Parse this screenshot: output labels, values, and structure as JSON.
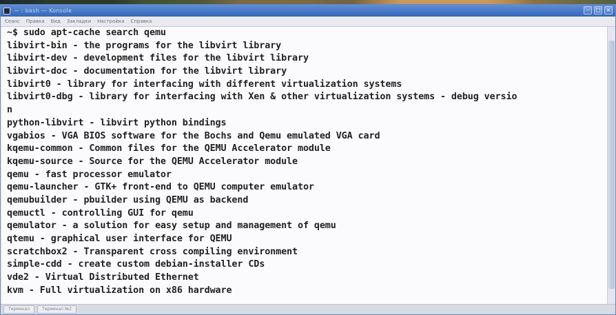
{
  "window": {
    "title": "~ : bash — Konsole",
    "menu": [
      "Сеанс",
      "Правка",
      "Вид",
      "Закладки",
      "Настройка",
      "Справка"
    ]
  },
  "terminal": {
    "lines": [
      "~$ sudo apt-cache search qemu",
      "libvirt-bin - the programs for the libvirt library",
      "libvirt-dev - development files for the libvirt library",
      "libvirt-doc - documentation for the libvirt library",
      "libvirt0 - library for interfacing with different virtualization systems",
      "libvirt0-dbg - library for interfacing with Xen & other virtualization systems - debug versio",
      "n",
      "python-libvirt - libvirt python bindings",
      "vgabios - VGA BIOS software for the Bochs and Qemu emulated VGA card",
      "kqemu-common - Common files for the QEMU Accelerator module",
      "kqemu-source - Source for the QEMU Accelerator module",
      "qemu - fast processor emulator",
      "qemu-launcher - GTK+ front-end to QEMU computer emulator",
      "qemubuilder - pbuilder using QEMU as backend",
      "qemuctl - controlling GUI for qemu",
      "qemulator - a solution for easy setup and management of qemu",
      "qtemu - graphical user interface for QEMU",
      "scratchbox2 - Transparent cross compiling environment",
      "simple-cdd - create custom debian-installer CDs",
      "vde2 - Virtual Distributed Ethernet",
      "kvm - Full virtualization on x86 hardware"
    ]
  },
  "statusbar": {
    "tabs": [
      "Терминал",
      "Терминал №2"
    ]
  }
}
